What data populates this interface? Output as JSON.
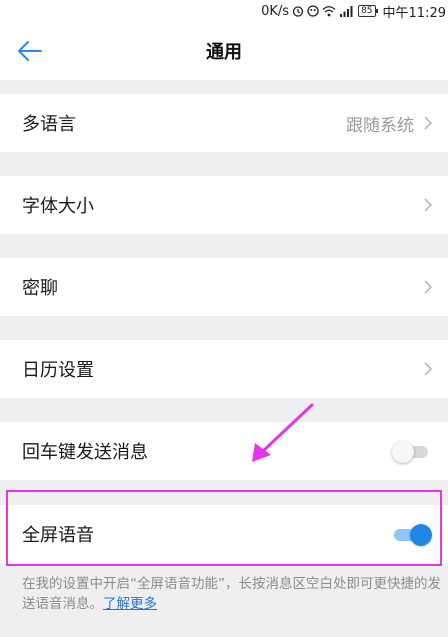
{
  "status_bar": {
    "speed": "0K/s",
    "battery": "85",
    "time": "中午11:29"
  },
  "nav": {
    "title": "通用"
  },
  "settings": {
    "language": {
      "label": "多语言",
      "value": "跟随系统"
    },
    "font_size": {
      "label": "字体大小"
    },
    "secret_chat": {
      "label": "密聊"
    },
    "calendar": {
      "label": "日历设置"
    },
    "enter_send": {
      "label": "回车键发送消息",
      "enabled": false
    },
    "fullscreen_voice": {
      "label": "全屏语音",
      "enabled": true
    }
  },
  "description": {
    "text": "在我的设置中开启“全屏语音功能”，长按消息区空白处即可更快捷的发送语音消息。",
    "link": "了解更多"
  },
  "colors": {
    "accent": "#1f87e6",
    "annotation": "#e535e8",
    "background": "#efeff2"
  }
}
